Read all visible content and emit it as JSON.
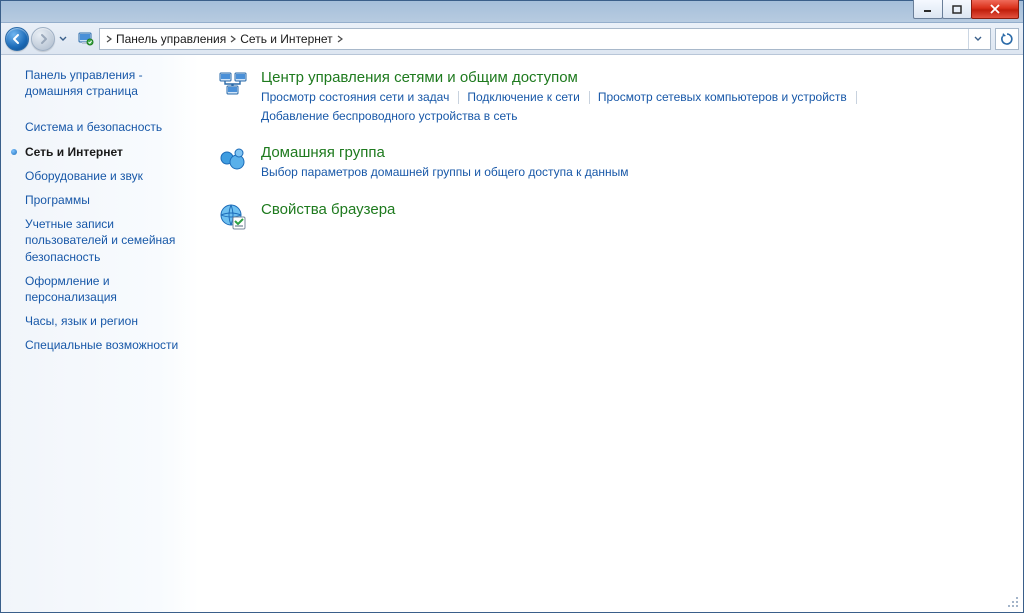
{
  "breadcrumb": {
    "root": "Панель управления",
    "current": "Сеть и Интернет"
  },
  "sidebar": {
    "home_l1": "Панель управления -",
    "home_l2": "домашняя страница",
    "items": [
      {
        "label": "Система и безопасность",
        "active": false
      },
      {
        "label": "Сеть и Интернет",
        "active": true
      },
      {
        "label": "Оборудование и звук",
        "active": false
      },
      {
        "label": "Программы",
        "active": false
      },
      {
        "label": "Учетные записи пользователей и семейная безопасность",
        "active": false
      },
      {
        "label": "Оформление и персонализация",
        "active": false
      },
      {
        "label": "Часы, язык и регион",
        "active": false
      },
      {
        "label": "Специальные возможности",
        "active": false
      }
    ]
  },
  "entries": [
    {
      "title": "Центр управления сетями и общим доступом",
      "links": [
        "Просмотр состояния сети и задач",
        "Подключение к сети",
        "Просмотр сетевых компьютеров и устройств",
        "Добавление беспроводного устройства в сеть"
      ]
    },
    {
      "title": "Домашняя группа",
      "links": [
        "Выбор параметров домашней группы и общего доступа к данным"
      ]
    },
    {
      "title": "Свойства браузера",
      "links": []
    }
  ]
}
